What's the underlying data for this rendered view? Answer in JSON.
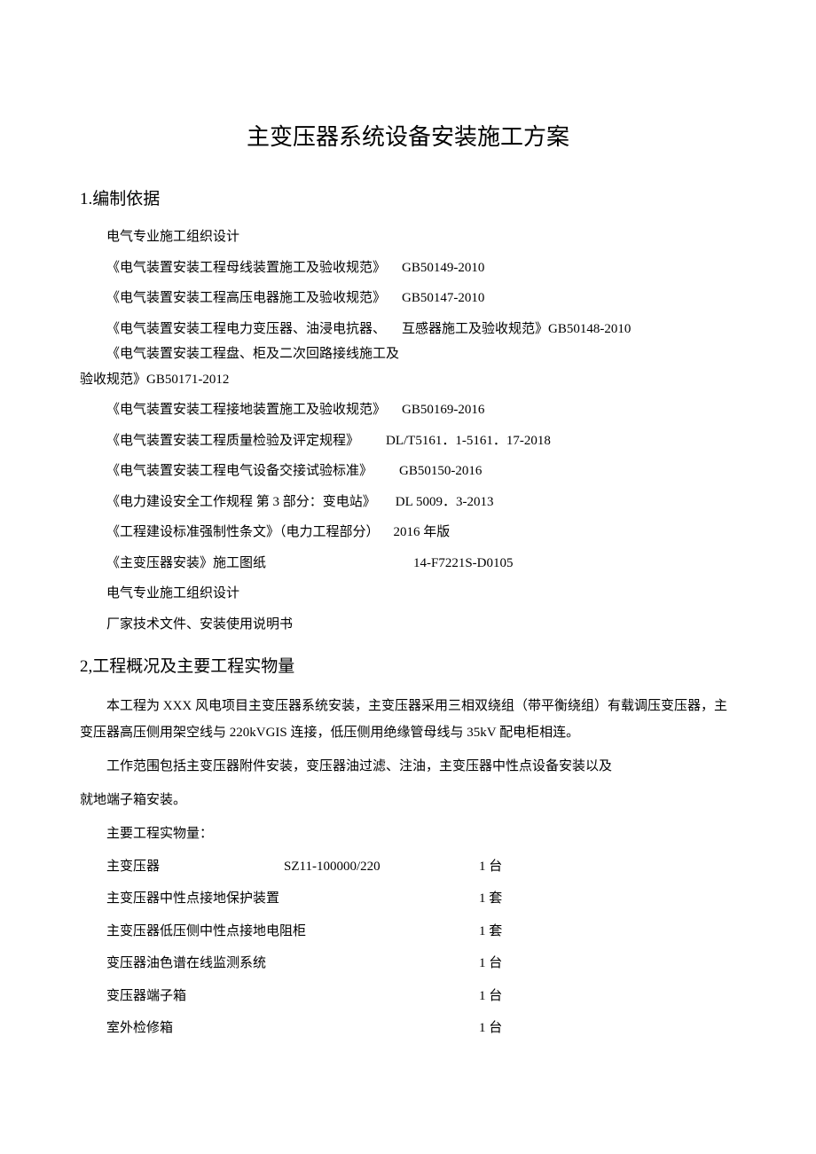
{
  "title": "主变压器系统设备安装施工方案",
  "sections": {
    "s1": "1.编制依据",
    "s2": "2,工程概况及主要工程实物量"
  },
  "refs": {
    "intro": "电气专业施工组织设计",
    "r1": {
      "name": "《电气装置安装工程母线装置施工及验收规范》",
      "code": "GB50149-2010"
    },
    "r2": {
      "name": "《电气装置安装工程高压电器施工及验收规范》",
      "code": "GB50147-2010"
    },
    "r3_line1_left": "《电气装置安装工程电力变压器、油浸电抗器、",
    "r3_line1_right": "互感器施工及验收规范》GB50148-2010",
    "r3_line2": "《电气装置安装工程盘、柜及二次回路接线施工及",
    "r3_line3": "验收规范》GB50171-2012",
    "r4": {
      "name": "《电气装置安装工程接地装置施工及验收规范》",
      "code": "GB50169-2016"
    },
    "r5": {
      "name": "《电气装置安装工程质量检验及评定规程》",
      "code": "DL/T5161．1-5161．17-2018"
    },
    "r6": {
      "name": "《电气装置安装工程电气设备交接试验标准》",
      "code": "GB50150-2016"
    },
    "r7": {
      "name": "《电力建设安全工作规程 第 3 部分：变电站》",
      "code": "DL 5009．3-2013"
    },
    "r8": {
      "name": "《工程建设标准强制性条文》（电力工程部分）",
      "code": "2016 年版"
    },
    "r9": {
      "name": "《主变压器安装》施工图纸",
      "code": "14-F7221S-D0105"
    },
    "r10": "电气专业施工组织设计",
    "r11": "厂家技术文件、安装使用说明书"
  },
  "overview": {
    "p1": "本工程为 XXX 风电项目主变压器系统安装，主变压器采用三相双绕组（带平衡绕组）有载调压变压器，主变压器高压侧用架空线与 220kVGIS 连接，低压侧用绝缘管母线与 35kV 配电柜相连。",
    "p2": "工作范围包括主变压器附件安装，变压器油过滤、注油，主变压器中性点设备安装以及",
    "p3": "就地端子箱安装。",
    "p4": "主要工程实物量："
  },
  "qty": {
    "q1": {
      "name": "主变压器",
      "model": "SZ11-100000/220",
      "count": "1 台"
    },
    "q2": {
      "name": "主变压器中性点接地保护装置",
      "model": "",
      "count": "1 套"
    },
    "q3": {
      "name": "主变压器低压侧中性点接地电阻柜",
      "model": "",
      "count": "1 套"
    },
    "q4": {
      "name": "变压器油色谱在线监测系统",
      "model": "",
      "count": "1 台"
    },
    "q5": {
      "name": "变压器端子箱",
      "model": "",
      "count": "1 台"
    },
    "q6": {
      "name": "室外检修箱",
      "model": "",
      "count": "1 台"
    }
  }
}
